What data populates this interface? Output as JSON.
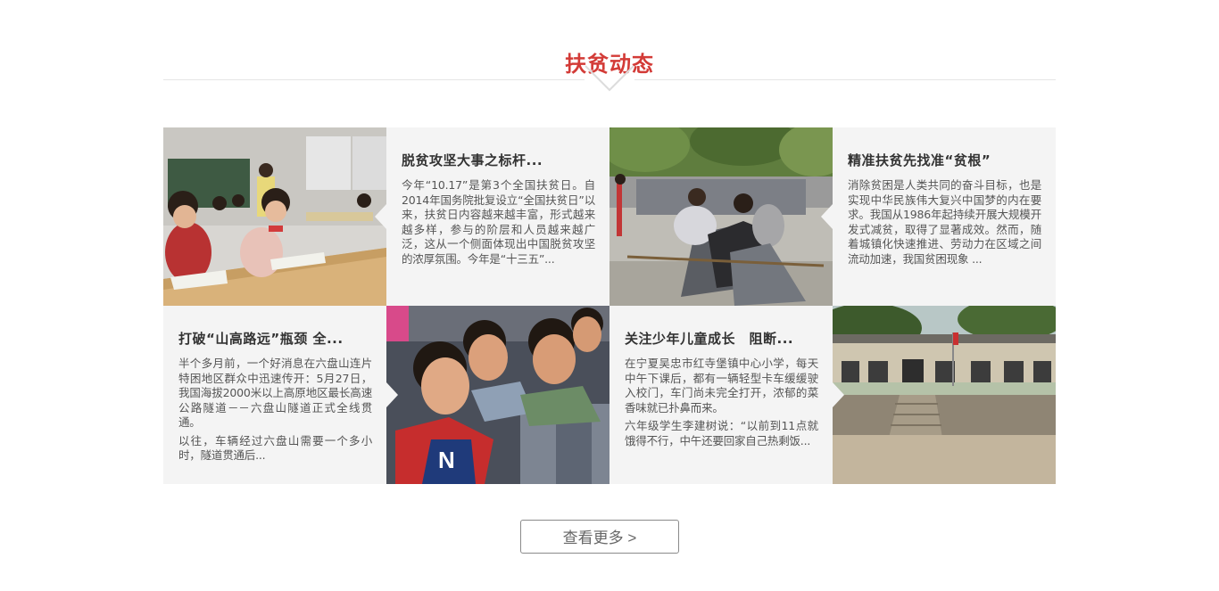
{
  "section": {
    "title": "扶贫动态"
  },
  "colors": {
    "accent": "#d33b37",
    "card_bg": "#f4f4f4",
    "divider": "#e6e6e6"
  },
  "news": [
    {
      "title": "脱贫攻坚大事之标杆...",
      "paragraphs": [
        "今年“10.17”是第3个全国扶贫日。自2014年国务院批复设立“全国扶贫日”以来，扶贫日内容越来越丰富，形式越来越多样，参与的阶层和人员越来越广泛，这从一个侧面体现出中国脱贫攻坚的浓厚氛围。今年是“十三五”..."
      ]
    },
    {
      "title": "精准扶贫先找准“贫根”",
      "paragraphs": [
        "消除贫困是人类共同的奋斗目标，也是实现中华民族伟大复兴中国梦的内在要求。我国从1986年起持续开展大规模开发式减贫，取得了显著成效。然而，随着城镇化快速推进、劳动力在区域之间流动加速，我国贫困现象 ..."
      ]
    },
    {
      "title": "打破“山高路远”瓶颈 全...",
      "paragraphs": [
        "半个多月前，一个好消息在六盘山连片特困地区群众中迅速传开：5月27日，我国海拔2000米以上高原地区最长高速公路隧道－－六盘山隧道正式全线贯通。",
        "以往，车辆经过六盘山需要一个多小时，隧道贯通后..."
      ]
    },
    {
      "title": "关注少年儿童成长　阻断...",
      "paragraphs": [
        "在宁夏吴忠市红寺堡镇中心小学，每天中午下课后，都有一辆轻型卡车缓缓驶入校门，车门尚未完全打开，浓郁的菜香味就已扑鼻而来。",
        "六年级学生李建树说：“以前到11点就饿得不行，中午还要回家自己热剩饭..."
      ]
    }
  ],
  "more_button": {
    "label": "查看更多 >"
  }
}
